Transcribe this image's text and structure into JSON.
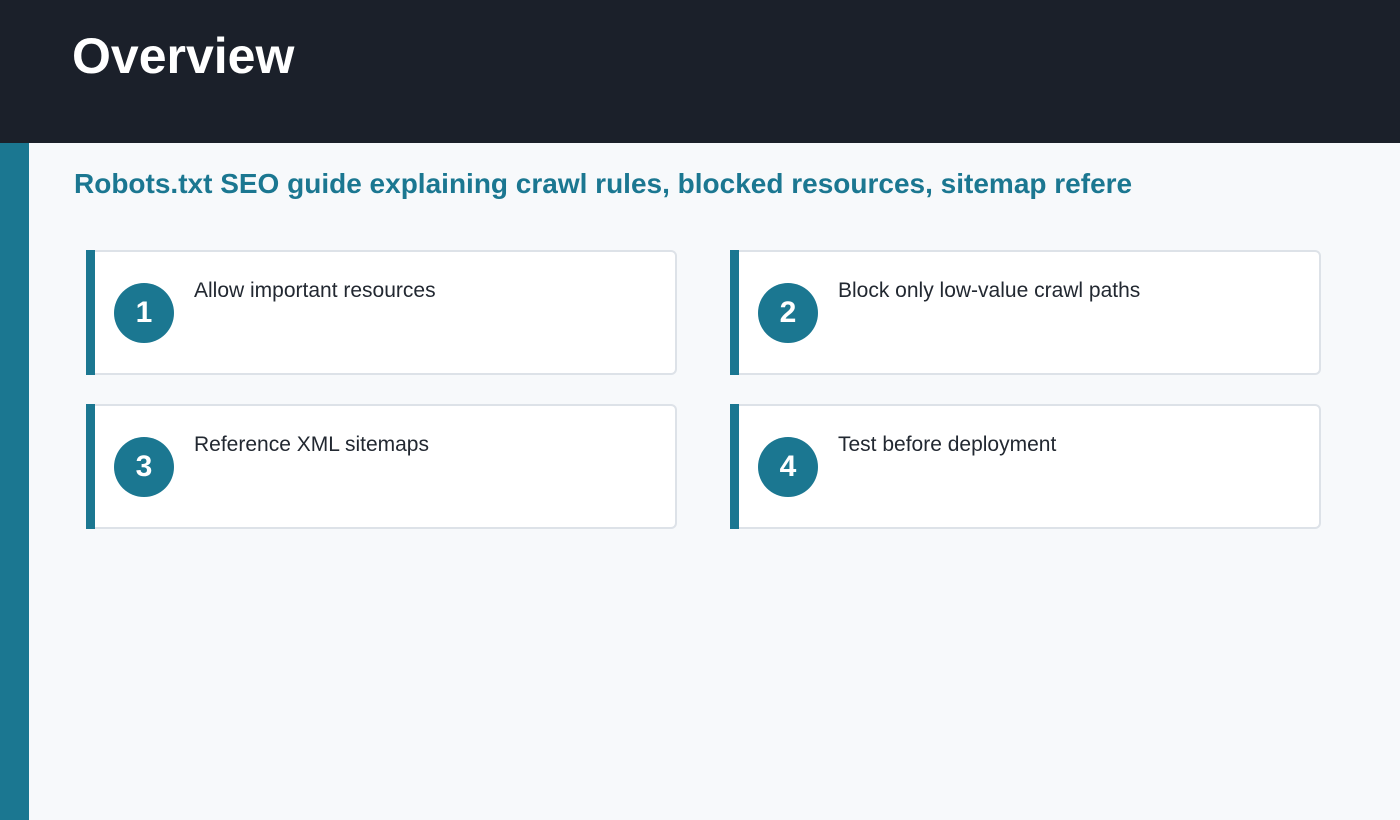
{
  "header": {
    "title": "Overview"
  },
  "main": {
    "subtitle": "Robots.txt SEO guide explaining crawl rules, blocked resources, sitemap refere",
    "cards": [
      {
        "number": "1",
        "label": "Allow important resources"
      },
      {
        "number": "2",
        "label": "Block only low-value crawl paths"
      },
      {
        "number": "3",
        "label": "Reference XML sitemaps"
      },
      {
        "number": "4",
        "label": "Test before deployment"
      }
    ]
  },
  "colors": {
    "header_bg": "#1b202a",
    "accent": "#1b7791",
    "background": "#f7f9fb",
    "card_border": "#dde2e8",
    "text": "#222831"
  }
}
